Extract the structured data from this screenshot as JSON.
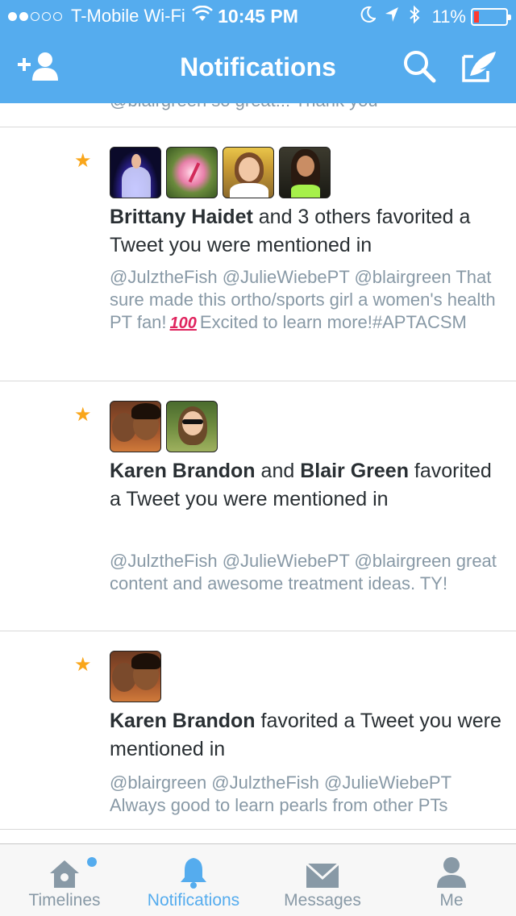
{
  "status_bar": {
    "carrier": "T-Mobile Wi-Fi",
    "signal_dots_filled": 2,
    "signal_dots_total": 5,
    "time": "10:45 PM",
    "battery_percent": "11%",
    "icons": [
      "wifi-icon",
      "moon-icon",
      "location-arrow-icon",
      "bluetooth-icon",
      "battery-icon"
    ]
  },
  "nav": {
    "title": "Notifications",
    "left_button_icon": "add-user-icon",
    "right_buttons": [
      "search-icon",
      "compose-icon"
    ]
  },
  "feed": {
    "partial_previous_tweet": "@blairgreen so great!!! Thank you",
    "notifications": [
      {
        "icon": "star-icon",
        "avatars": [
          "Brittany Haidet",
          "flower-avatar",
          "woman-avatar",
          "girl-avatar"
        ],
        "actor_primary": "Brittany Haidet",
        "action_text": " and 3 others favorited a Tweet you were mentioned in",
        "tweet_before_emoji": "@JulztheFish @JulieWiebePT @blairgreen That sure made this ortho/sports girl a women's health PT fan!",
        "emoji": "100",
        "tweet_after_emoji": "Excited to learn more!#APTACSM"
      },
      {
        "icon": "star-icon",
        "avatars": [
          "Karen Brandon",
          "Blair Green"
        ],
        "actor_primary": "Karen Brandon",
        "connector": " and ",
        "actor_secondary": "Blair Green",
        "action_text": " favorited a Tweet you were mentioned in",
        "tweet": "@JulztheFish @JulieWiebePT @blairgreen great content and awesome treatment ideas. TY!"
      },
      {
        "icon": "star-icon",
        "avatars": [
          "Karen Brandon"
        ],
        "actor_primary": "Karen Brandon",
        "action_text": " favorited a Tweet you were mentioned in",
        "tweet": "@blairgreen @JulztheFish @JulieWiebePT Always good to learn pearls from other PTs"
      }
    ]
  },
  "tab_bar": {
    "tabs": [
      {
        "label": "Timelines",
        "icon": "home-icon",
        "has_dot": true
      },
      {
        "label": "Notifications",
        "icon": "bell-icon",
        "active": true
      },
      {
        "label": "Messages",
        "icon": "envelope-icon"
      },
      {
        "label": "Me",
        "icon": "person-icon"
      }
    ]
  },
  "colors": {
    "brand_blue": "#55acee",
    "star": "#f9a61b",
    "secondary_text": "#8899a6",
    "primary_text": "#292f33"
  }
}
